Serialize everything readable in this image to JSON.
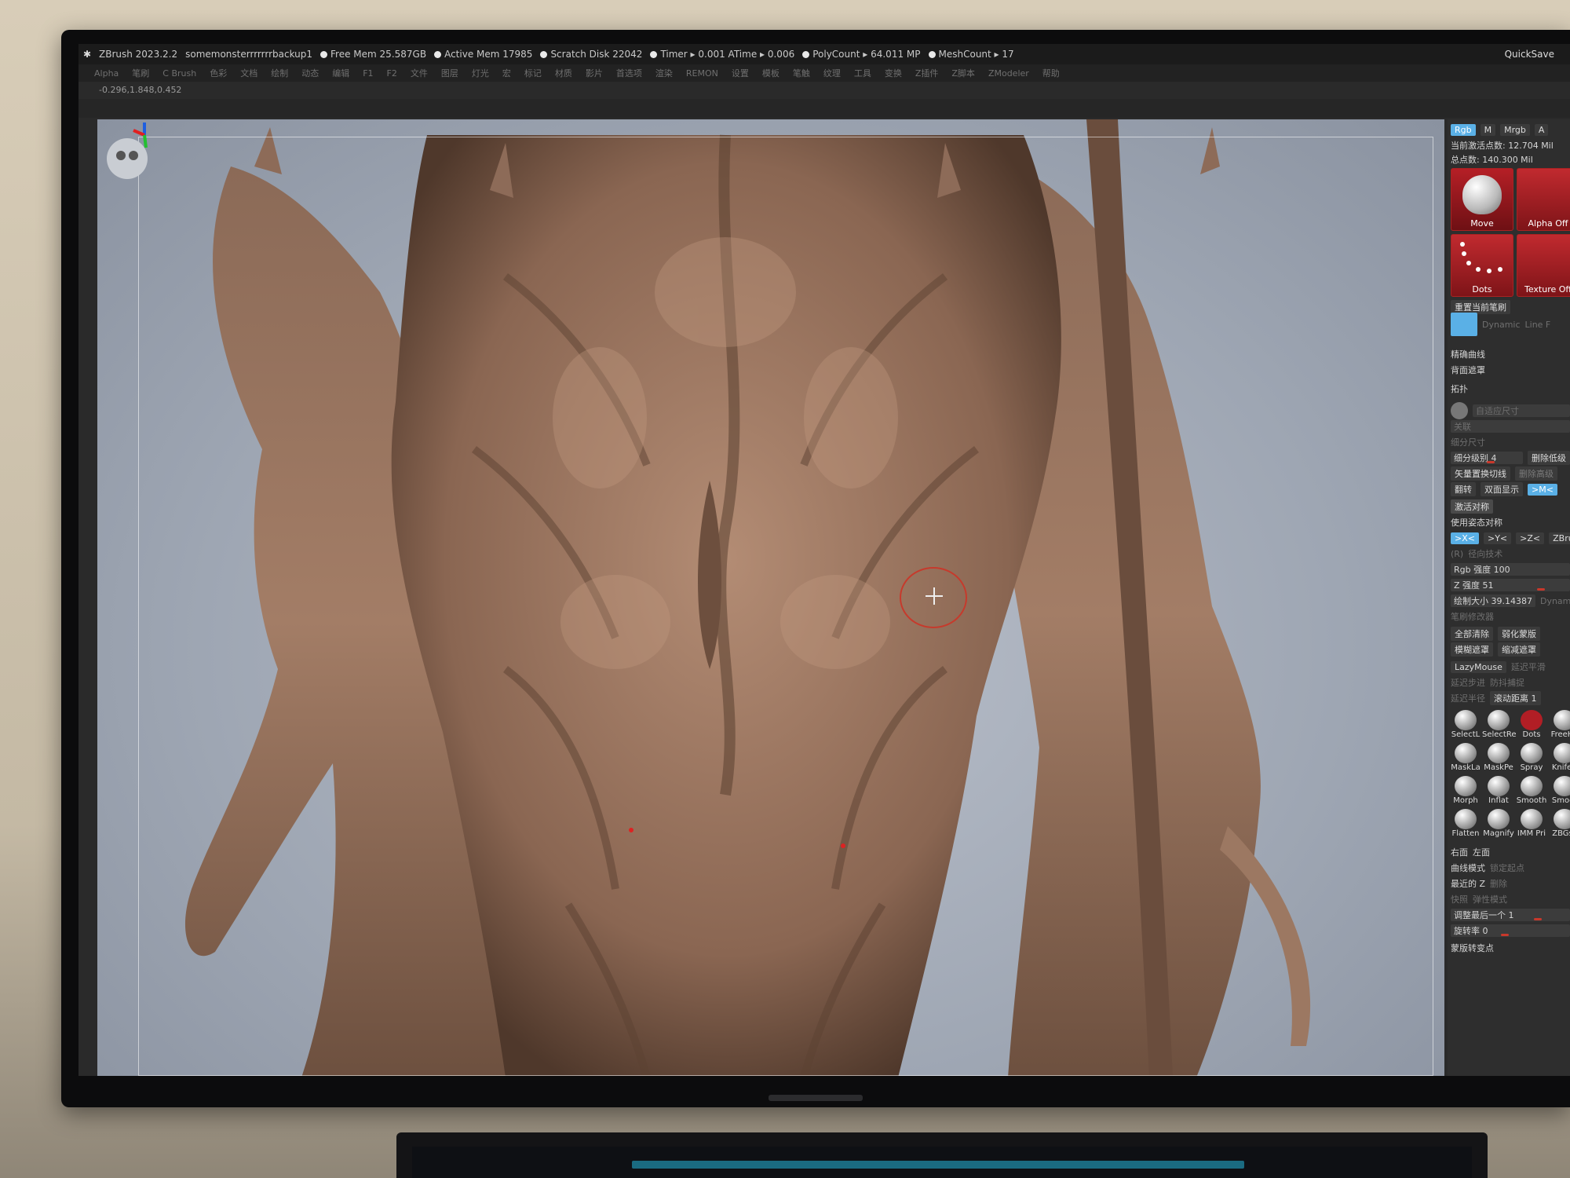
{
  "app": {
    "title": "ZBrush 2023.2.2",
    "document": "somemonsterrrrrrrbackup1",
    "quicksave": "QuickSave"
  },
  "status": [
    {
      "label": "Free Mem 25.587GB"
    },
    {
      "label": "Active Mem 17985"
    },
    {
      "label": "Scratch Disk 22042"
    },
    {
      "label": "Timer ▸ 0.001 ATime ▸ 0.006"
    },
    {
      "label": "PolyCount ▸ 64.011 MP"
    },
    {
      "label": "MeshCount ▸ 17"
    }
  ],
  "menu": [
    "Alpha",
    "笔刷",
    "C Brush",
    "色彩",
    "文档",
    "绘制",
    "动态",
    "编辑",
    "F1",
    "F2",
    "文件",
    "图层",
    "灯光",
    "宏",
    "标记",
    "材质",
    "影片",
    "首选项",
    "渲染",
    "REMON",
    "设置",
    "模板",
    "笔触",
    "纹理",
    "工具",
    "变换",
    "Z插件",
    "Z脚本",
    "ZModeler",
    "帮助"
  ],
  "coords": "-0.296,1.848,0.452",
  "panel": {
    "color_modes": [
      "Rgb",
      "M",
      "Mrgb",
      "A"
    ],
    "active_points": "当前激活点数: 12.704 Mil",
    "total_points": "总点数: 140.300 Mil",
    "tiles": [
      "Move",
      "Alpha Off",
      "Dots",
      "Texture Off"
    ],
    "reset_brush": "重置当前笔刷",
    "items": {
      "precise_curve": "精确曲线",
      "back_mask": "背面遮罩",
      "topology": "拓扑",
      "dynamic": "Dynamic",
      "line_fill": "Line F",
      "adaptive_size": "自适应尺寸",
      "off": "关联",
      "subdiv_size": "细分尺寸",
      "subdiv_level": "细分级别 4",
      "delete_lower": "删除低级",
      "vector_switch": "矢量置换切线",
      "delete_higher": "删除高级",
      "flip": "翻转",
      "double_sided": "双面显示",
      "m_label": ">M<",
      "activate_sym": "激活对称",
      "use_pose_sym": "使用姿态对称",
      "x": ">X<",
      "y": ">Y<",
      "z": ">Z<",
      "zbrush": "ZBrus",
      "r": "(R)",
      "radial": "径向技术",
      "rgb_intensity": "Rgb 强度 100",
      "z_intensity": "Z 强度 51",
      "draw_size": "绘制大小 39.14387",
      "dynamic2": "Dynami",
      "brush_modifier": "笔刷修改器",
      "clear_all": "全部清除",
      "soften_mask": "弱化蒙版",
      "blur_mask": "模糊遮罩",
      "shrink_mask": "缩减遮罩",
      "lazymouse": "LazyMouse",
      "lazy_smooth": "延迟平滑",
      "lazy_step": "延迟步进",
      "jitter": "防抖捕捉",
      "lazy_radius": "延迟半径",
      "lazy_dist": "滚动距离 1"
    },
    "brushes": [
      {
        "name": "SelectL"
      },
      {
        "name": "SelectRe"
      },
      {
        "name": "Dots"
      },
      {
        "name": "FreeHa"
      },
      {
        "name": "MaskLa"
      },
      {
        "name": "MaskPe"
      },
      {
        "name": "Spray"
      },
      {
        "name": "KnifeC"
      },
      {
        "name": "Morph"
      },
      {
        "name": "Inflat"
      },
      {
        "name": "Smooth"
      },
      {
        "name": "Smoot"
      },
      {
        "name": "Flatten"
      },
      {
        "name": "Magnify"
      },
      {
        "name": "IMM Pri"
      },
      {
        "name": "ZBGs_"
      }
    ],
    "bottom": {
      "right_side": "右面",
      "left_side": "左面",
      "curve_mode": "曲线模式",
      "lock_start": "锁定起点",
      "nearest_z": "最近的 Z",
      "delete": "删除",
      "snap": "快照",
      "elastic": "弹性模式",
      "adjust_last": "调整最后一个 1",
      "rotation": "旋转率 0",
      "mask_pivot": "蒙版转变点"
    }
  }
}
